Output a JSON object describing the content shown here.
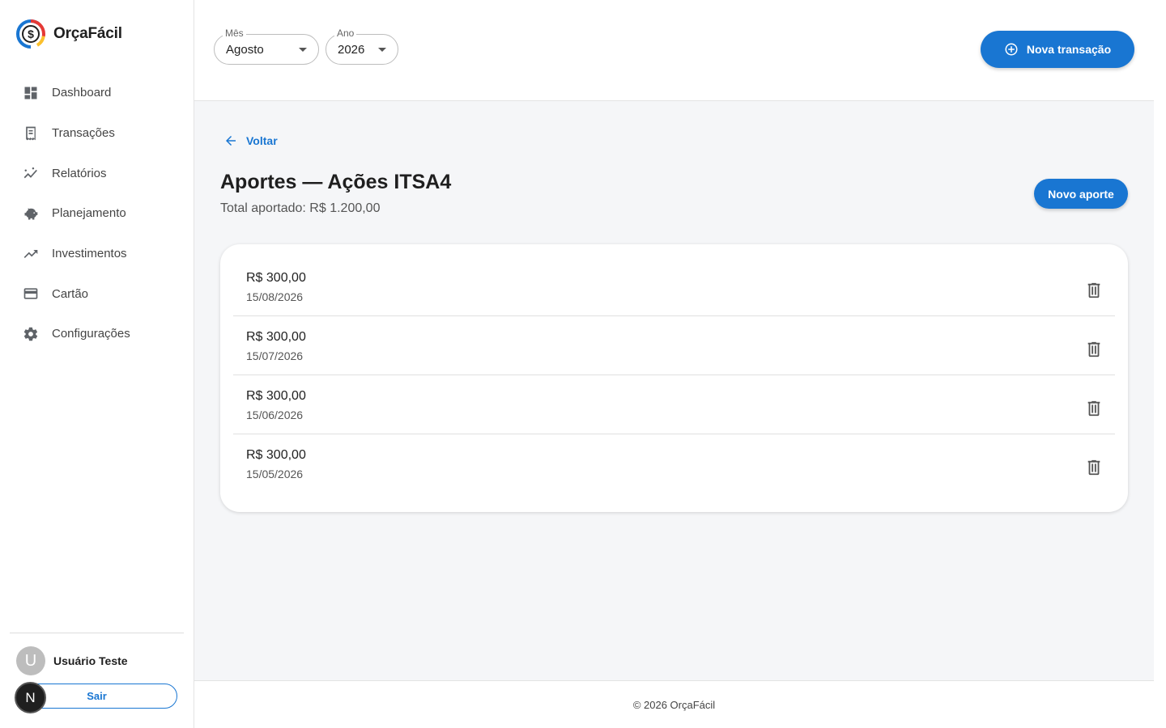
{
  "app": {
    "name": "OrçaFácil"
  },
  "sidebar": {
    "items": [
      {
        "label": "Dashboard",
        "icon": "dashboard-icon"
      },
      {
        "label": "Transações",
        "icon": "receipt-icon"
      },
      {
        "label": "Relatórios",
        "icon": "report-chart-icon"
      },
      {
        "label": "Planejamento",
        "icon": "piggy-bank-icon"
      },
      {
        "label": "Investimentos",
        "icon": "trending-up-icon"
      },
      {
        "label": "Cartão",
        "icon": "credit-card-icon"
      },
      {
        "label": "Configurações",
        "icon": "gear-icon"
      }
    ],
    "user": {
      "initial": "U",
      "name": "Usuário Teste"
    },
    "logout_label": "Sair",
    "badge": "N"
  },
  "header": {
    "month": {
      "label": "Mês",
      "value": "Agosto"
    },
    "year": {
      "label": "Ano",
      "value": "2026"
    },
    "new_transaction_label": "Nova transação"
  },
  "page": {
    "back_label": "Voltar",
    "title": "Aportes — Ações ITSA4",
    "subtitle": "Total aportado: R$ 1.200,00",
    "new_aporte_label": "Novo aporte",
    "aportes": [
      {
        "amount": "R$ 300,00",
        "date": "15/08/2026"
      },
      {
        "amount": "R$ 300,00",
        "date": "15/07/2026"
      },
      {
        "amount": "R$ 300,00",
        "date": "15/06/2026"
      },
      {
        "amount": "R$ 300,00",
        "date": "15/05/2026"
      }
    ]
  },
  "footer": {
    "text": "© 2026 OrçaFácil"
  },
  "colors": {
    "primary": "#1976d2",
    "background": "#f5f6f8"
  }
}
